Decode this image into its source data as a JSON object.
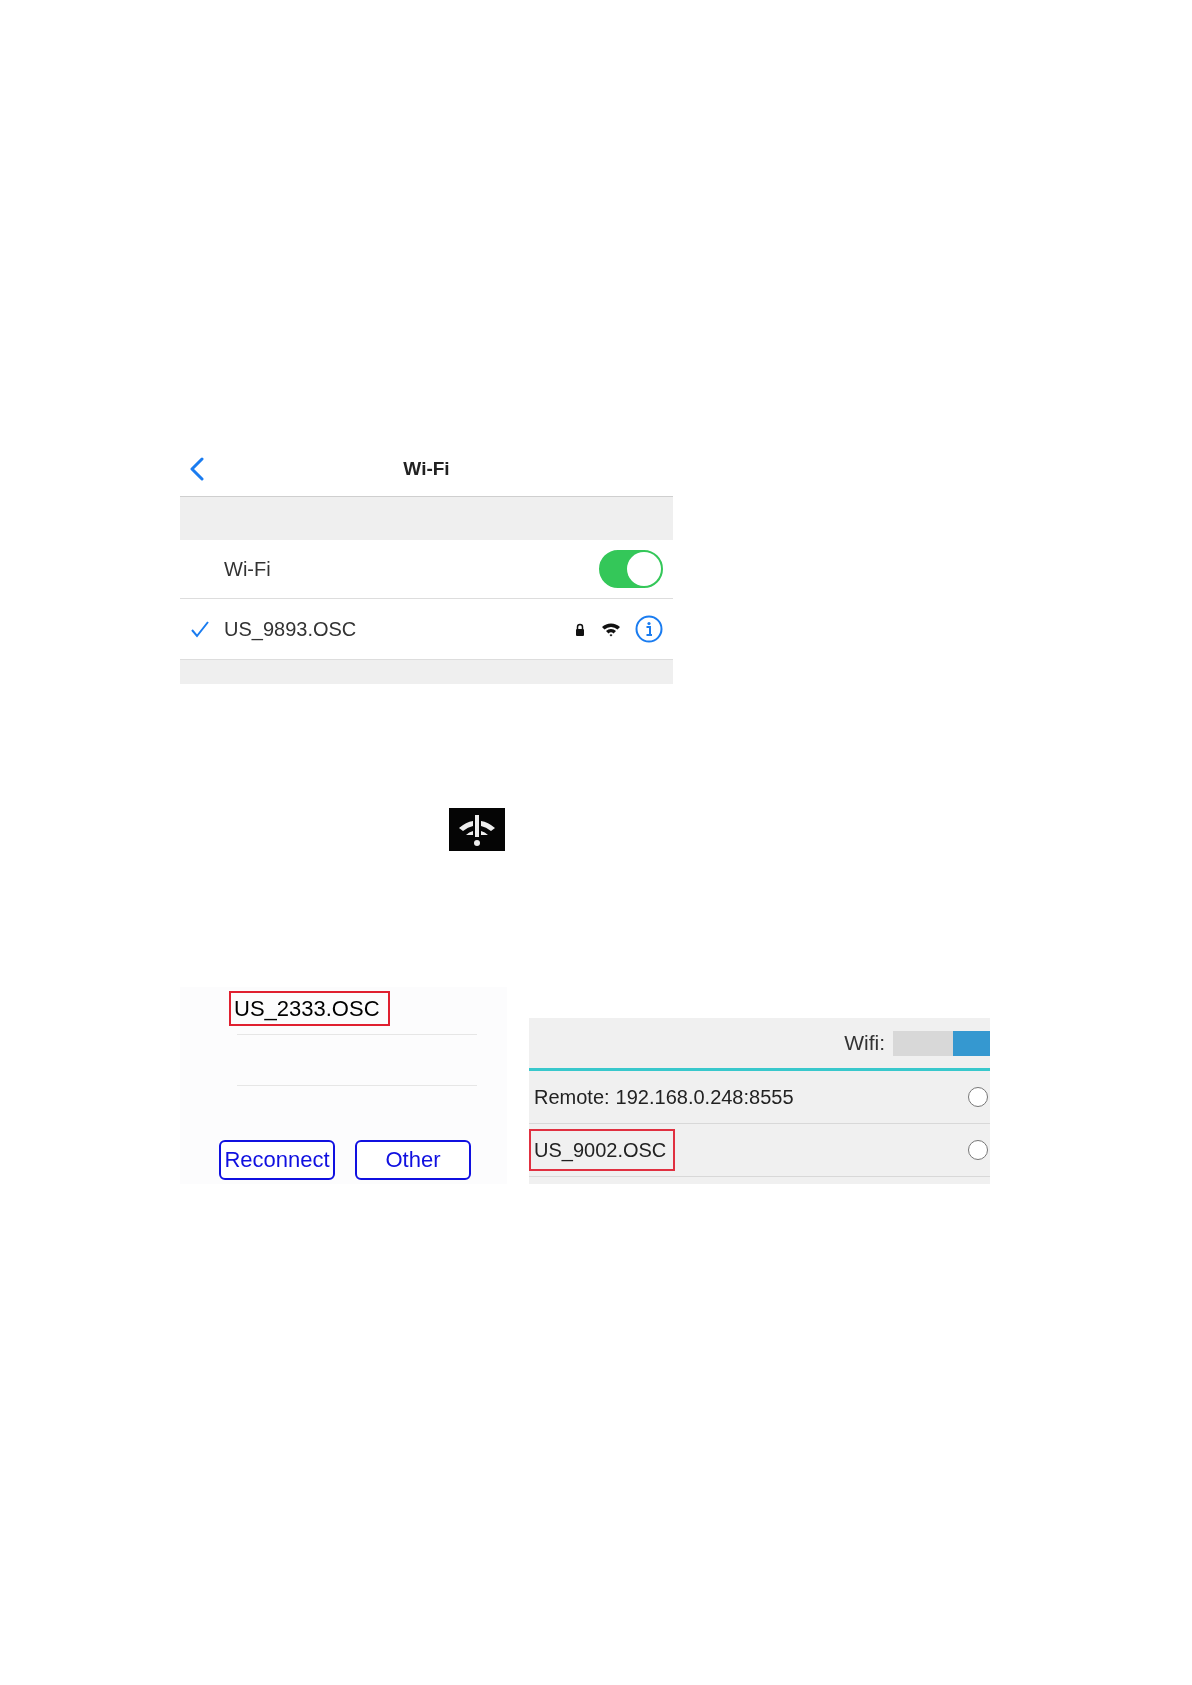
{
  "ios_wifi_screen": {
    "title": "Wi-Fi",
    "wifi_switch": {
      "label": "Wi-Fi",
      "on": true
    },
    "networks": [
      {
        "name": "US_9893.OSC",
        "selected": true,
        "locked": true
      }
    ]
  },
  "reconnect_dialog": {
    "network": "US_2333.OSC",
    "highlighted": true,
    "buttons": [
      "Reconnect",
      "Other"
    ]
  },
  "android_wifi_screen": {
    "wifi_switch": {
      "label": "Wifi:",
      "on": true
    },
    "rows": [
      {
        "label": "Remote:",
        "value": "192.168.0.248:8555",
        "selected": false,
        "highlighted": false
      },
      {
        "label": "",
        "value": "US_9002.OSC",
        "selected": false,
        "highlighted": true
      }
    ]
  }
}
